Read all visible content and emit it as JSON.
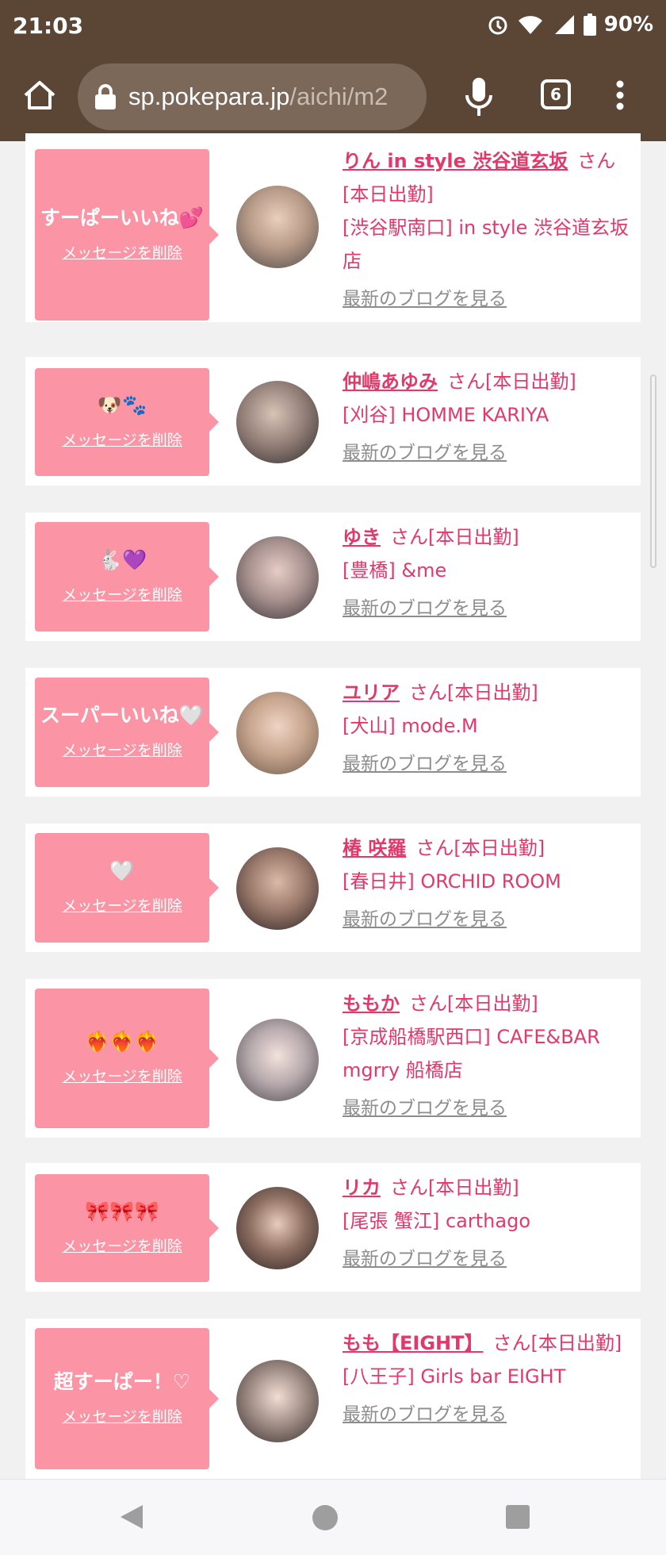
{
  "status_bar": {
    "time": "21:03",
    "battery": "90%"
  },
  "browser": {
    "url_host": "sp.pokepara.jp",
    "url_path": "/aichi/m2",
    "tab_count": "6"
  },
  "colors": {
    "accent": "#e2396b",
    "bubble": "#fb95a5",
    "chrome": "#5b4636"
  },
  "cards": [
    {
      "message": "すーぱーいいね💕",
      "delete_label": "メッセージを削除",
      "name": "りん in style 渋谷道玄坂",
      "honorific": "さん",
      "status": "[本日出勤]",
      "shop": "[渋谷駅南口] in style 渋谷道玄坂店",
      "blog_label": "最新のブログを見る"
    },
    {
      "message": "🐶🐾",
      "delete_label": "メッセージを削除",
      "name": "仲嶋あゆみ",
      "honorific": "さん",
      "status": "[本日出勤]",
      "shop": "[刈谷] HOMME KARIYA",
      "blog_label": "最新のブログを見る"
    },
    {
      "message": "🐇💜",
      "delete_label": "メッセージを削除",
      "name": "ゆき",
      "honorific": "さん",
      "status": "[本日出勤]",
      "shop": "[豊橋] &me",
      "blog_label": "最新のブログを見る"
    },
    {
      "message": "スーパーいいね🤍",
      "delete_label": "メッセージを削除",
      "name": "ユリア",
      "honorific": "さん",
      "status": "[本日出勤]",
      "shop": "[犬山] mode.M",
      "blog_label": "最新のブログを見る"
    },
    {
      "message": "🤍",
      "delete_label": "メッセージを削除",
      "name": "椿 咲羅",
      "honorific": "さん",
      "status": "[本日出勤]",
      "shop": "[春日井] ORCHID ROOM",
      "blog_label": "最新のブログを見る"
    },
    {
      "message": "❤️‍🔥❤️‍🔥❤️‍🔥",
      "delete_label": "メッセージを削除",
      "name": "ももか",
      "honorific": "さん",
      "status": "[本日出勤]",
      "shop": "[京成船橋駅西口] CAFE&BAR mgrry 船橋店",
      "blog_label": "最新のブログを見る"
    },
    {
      "message": "🎀🎀🎀",
      "delete_label": "メッセージを削除",
      "name": "リカ",
      "honorific": "さん",
      "status": "[本日出勤]",
      "shop": "[尾張 蟹江] carthago",
      "blog_label": "最新のブログを見る"
    },
    {
      "message": "超すーぱー！♡",
      "delete_label": "メッセージを削除",
      "name": "もも【EIGHT】",
      "honorific": "さん",
      "status": "[本日出勤]",
      "shop": "[八王子] Girls bar EIGHT",
      "blog_label": "最新のブログを見る"
    }
  ]
}
